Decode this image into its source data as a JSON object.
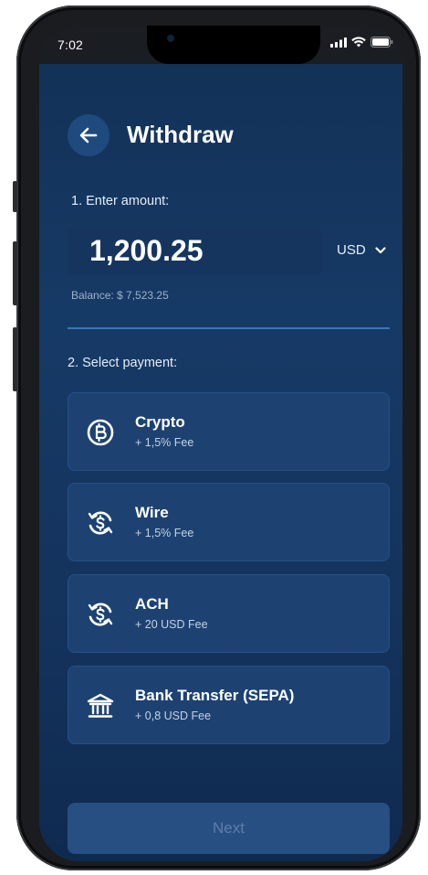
{
  "status_bar": {
    "time": "7:02"
  },
  "header": {
    "title": "Withdraw",
    "back_icon": "arrow-left-icon"
  },
  "amount_section": {
    "step_label": "1. Enter amount:",
    "amount_value": "1,200.25",
    "currency": "USD",
    "balance_text": "Balance: $ 7,523.25"
  },
  "payment_section": {
    "step_label": "2. Select payment:",
    "methods": [
      {
        "name": "Crypto",
        "fee": "+ 1,5% Fee",
        "icon": "bitcoin-icon"
      },
      {
        "name": "Wire",
        "fee": "+ 1,5% Fee",
        "icon": "dollar-exchange-icon"
      },
      {
        "name": "ACH",
        "fee": "+ 20 USD Fee",
        "icon": "dollar-exchange-icon"
      },
      {
        "name": "Bank Transfer (SEPA)",
        "fee": "+ 0,8 USD Fee",
        "icon": "bank-icon"
      }
    ]
  },
  "footer": {
    "next_label": "Next"
  },
  "colors": {
    "background": "#163a66",
    "card": "#1d4272",
    "accent_line": "#3a76b8",
    "button_disabled": "#284f82"
  }
}
